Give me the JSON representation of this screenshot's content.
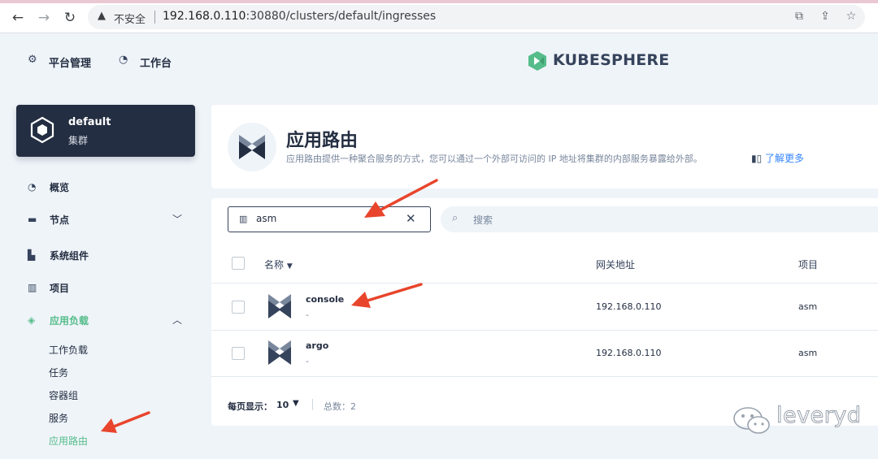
{
  "browser": {
    "back_icon": "arrow-left-icon",
    "forward_icon": "arrow-right-icon",
    "reload_icon": "reload-icon",
    "security_label": "不安全",
    "url_host": "192.168.0.110",
    "url_rest": ":30880/clusters/default/ingresses"
  },
  "header": {
    "platform_label": "平台管理",
    "workbench_label": "工作台",
    "logo_text": "KUBESPHERE"
  },
  "cluster": {
    "name": "default",
    "type_label": "集群"
  },
  "sidebar": {
    "overview": "概览",
    "nodes": "节点",
    "components": "系统组件",
    "projects": "项目",
    "workloads_group": "应用负载",
    "sub_items": [
      "工作负载",
      "任务",
      "容器组",
      "服务",
      "应用路由"
    ]
  },
  "banner": {
    "title": "应用路由",
    "description": "应用路由提供一种聚合服务的方式，您可以通过一个外部可访问的 IP 地址将集群的内部服务暴露给外部。",
    "learn_more": "了解更多"
  },
  "filter": {
    "project_value": "asm",
    "search_placeholder": "搜索"
  },
  "table": {
    "columns": {
      "name": "名称",
      "gateway": "网关地址",
      "project": "项目"
    },
    "rows": [
      {
        "name": "console",
        "desc": "-",
        "gateway": "192.168.0.110",
        "project": "asm"
      },
      {
        "name": "argo",
        "desc": "-",
        "gateway": "192.168.0.110",
        "project": "asm"
      }
    ]
  },
  "pagination": {
    "per_page_label": "每页显示：",
    "per_page_value": "10",
    "total_label": "总数：",
    "total_value": "2"
  },
  "watermark": {
    "text": "leveryd"
  },
  "colors": {
    "accent_green": "#55bc8a",
    "dark_navy": "#242e42",
    "annotation_red": "#e8452c",
    "link_blue": "#3385ff"
  }
}
